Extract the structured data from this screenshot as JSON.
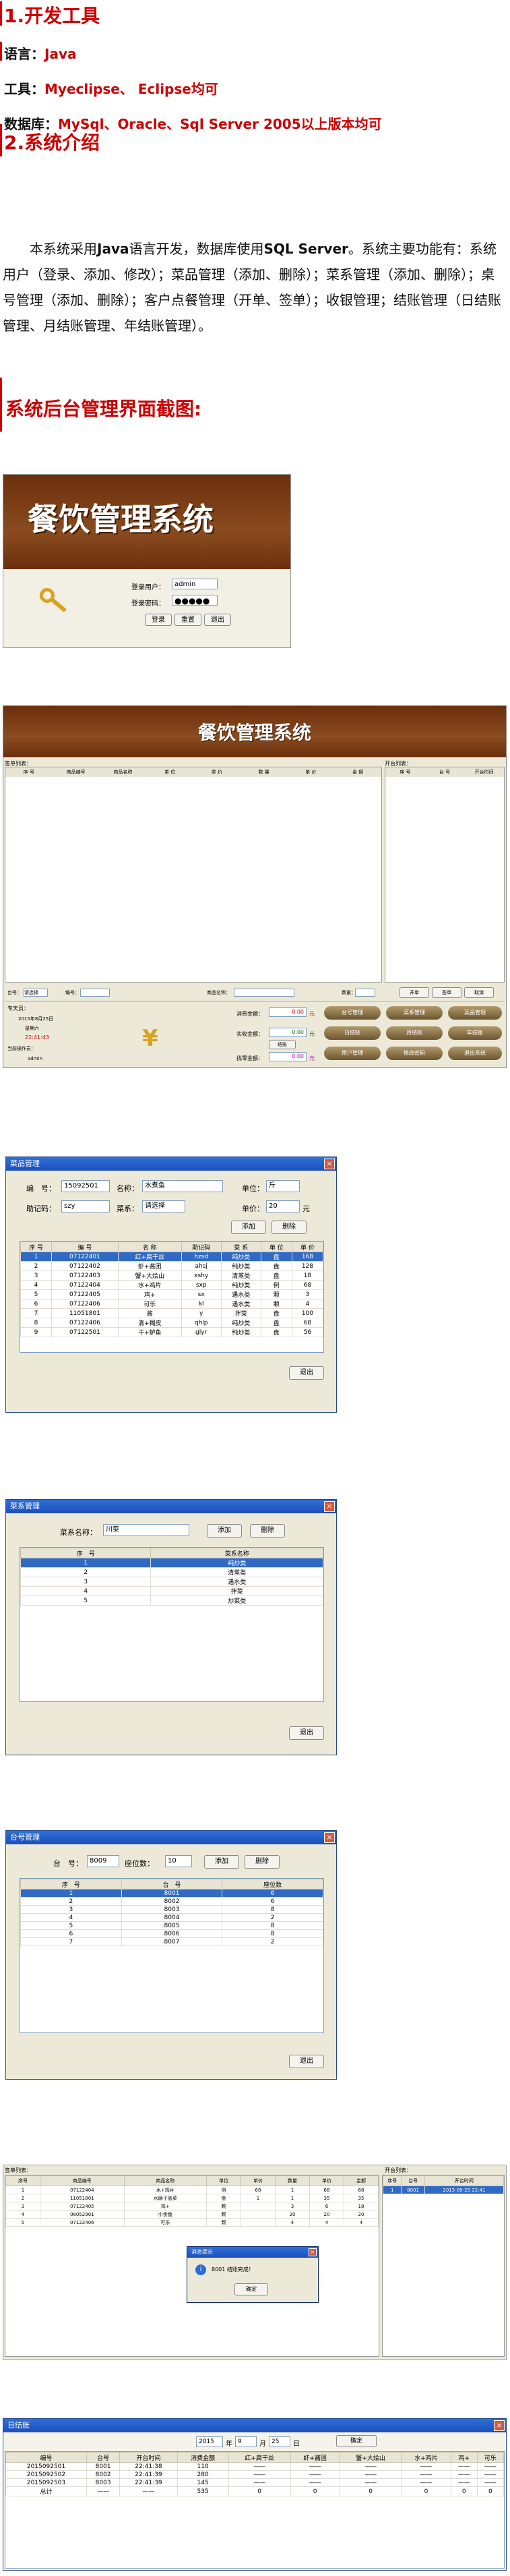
{
  "sections": {
    "tools_heading": "1.开发工具",
    "lang_label": "语言：",
    "lang_value": "Java",
    "tool_label": "工具：",
    "tool_value": "Myeclipse、 Eclipse均可",
    "db_label": "数据库：",
    "db_value": "MySql、Oracle、Sql Server 2005以上版本均可",
    "intro_heading": "2.系统介绍",
    "intro_p1": "本系统采用",
    "intro_java": "Java",
    "intro_p2": "语言开发，数据库使用",
    "intro_sql": "SQL Server",
    "intro_p3": "。系统主要功能有：系统用户（登录、添加、修改）；菜品管理（添加、删除）；菜系管理（添加、删除）；桌号管理（添加、删除）；客户点餐管理（开单、签单）；收银管理；结账管理（日结账管理、月结账管理、年结账管理）。",
    "screens_heading": "系统后台管理界面截图:"
  },
  "login": {
    "title": "餐饮管理系统",
    "user_label": "登录用户：",
    "user_value": "admin",
    "pwd_label": "登录密码：",
    "pwd_value": "●●●●●",
    "btn_login": "登录",
    "btn_reset": "重置",
    "btn_exit": "退出"
  },
  "main": {
    "title": "餐饮管理系统",
    "left_panel": "签单列表：",
    "right_panel": "开台列表：",
    "cols": [
      "序 号",
      "商品编号",
      "商品名称",
      "单 位",
      "单 价",
      "数 量",
      "单 价",
      "金 额"
    ],
    "rcols": [
      "序 号",
      "台 号",
      "开台时间"
    ],
    "bar": [
      "台号：",
      "请选择",
      "编号：",
      "商品名称：",
      "数量：",
      "开单",
      "签单",
      "取消"
    ],
    "user_lbl": "专天员：",
    "date": "2015年8月25日",
    "weekday": "星期六",
    "time": "22:41:43",
    "cur": "当前操作员：",
    "admin": "admin",
    "pay1": "消费金额：",
    "pay2": "实收金额：",
    "pay3": "找零金额：",
    "v1": "0.00",
    "v2": "0.00",
    "v3": "0.00",
    "yuan": "元",
    "checkout": "结账",
    "actions": [
      "台号管理",
      "菜系管理",
      "菜品管理",
      "日结账",
      "月结账",
      "年结账",
      "用户管理",
      "修改密码",
      "退出系统"
    ]
  },
  "menu": {
    "title": "菜品管理",
    "lbl_no": "编　号：",
    "no": "15092501",
    "lbl_name": "名称：",
    "name": "水煮鱼",
    "lbl_unit": "单位：",
    "unit": "斤",
    "lbl_code": "助记码：",
    "code": "szy",
    "lbl_type": "菜系：",
    "type": "请选择",
    "lbl_price": "单价：",
    "price": "20",
    "yuan": "元",
    "add": "添加",
    "del": "删除",
    "exit": "退出",
    "cols": [
      "序 号",
      "编 号",
      "名 称",
      "助记码",
      "菜 系",
      "单 位",
      "单 价"
    ],
    "rows": [
      [
        "1",
        "07122401",
        "红+腐干丝",
        "hzsd",
        "纯炒类",
        "盘",
        "168"
      ],
      [
        "2",
        "07122402",
        "虾+酱团",
        "ahsj",
        "纯炒类",
        "盘",
        "128"
      ],
      [
        "3",
        "07122403",
        "蟹+大烩山",
        "xshy",
        "清蒸类",
        "盘",
        "18"
      ],
      [
        "4",
        "07122404",
        "水+鸡片",
        "sxp",
        "纯炒类",
        "例",
        "68"
      ],
      [
        "5",
        "07122405",
        "鸡+",
        "sx",
        "遇水类",
        "颗",
        "3"
      ],
      [
        "6",
        "07122406",
        "可乐",
        "kl",
        "遇水类",
        "颗",
        "4"
      ],
      [
        "7",
        "11051801",
        "酱",
        "y",
        "拌菜",
        "盘",
        "100"
      ],
      [
        "8",
        "07122406",
        "清+糊皮",
        "qhlp",
        "纯炒类",
        "盘",
        "68"
      ],
      [
        "9",
        "07122501",
        "干+鲈鱼",
        "glyr",
        "纯炒类",
        "盘",
        "56"
      ]
    ]
  },
  "cuisine": {
    "title": "菜系管理",
    "lbl": "菜系名称：",
    "val": "川菜",
    "add": "添加",
    "del": "删除",
    "exit": "退出",
    "cols": [
      "序　号",
      "菜系名称"
    ],
    "rows": [
      [
        "1",
        "纯炒类"
      ],
      [
        "2",
        "清蒸类"
      ],
      [
        "3",
        "遇水类"
      ],
      [
        "4",
        "拌菜"
      ],
      [
        "5",
        "炒菜类"
      ]
    ]
  },
  "table": {
    "title": "台号管理",
    "lbl_no": "台　号：",
    "no": "8009",
    "lbl_seat": "座位数：",
    "seat": "10",
    "add": "添加",
    "del": "删除",
    "exit": "退出",
    "cols": [
      "序　号",
      "台　号",
      "座位数"
    ],
    "rows": [
      [
        "1",
        "8001",
        "6"
      ],
      [
        "2",
        "8002",
        "6"
      ],
      [
        "3",
        "8003",
        "8"
      ],
      [
        "4",
        "8004",
        "2"
      ],
      [
        "5",
        "8005",
        "8"
      ],
      [
        "6",
        "8006",
        "8"
      ],
      [
        "7",
        "8007",
        "2"
      ]
    ]
  },
  "order": {
    "left_panel": "签单列表：",
    "right_panel": "开台列表：",
    "cols": [
      "序号",
      "商品编号",
      "商品名称",
      "单位",
      "单价",
      "数量",
      "单价",
      "金额"
    ],
    "rows": [
      [
        "1",
        "07122404",
        "水+鸡片",
        "例",
        "68",
        "1",
        "68",
        "68"
      ],
      [
        "2",
        "11051801",
        "水磨子盖菜",
        "盘",
        "1",
        "1",
        "35",
        "35"
      ],
      [
        "3",
        "07122405",
        "鸡+",
        "颗",
        "",
        "3",
        "6",
        "18"
      ],
      [
        "4",
        "08052901",
        "小食鱼",
        "颗",
        "",
        "20",
        "20",
        "20"
      ],
      [
        "5",
        "07122406",
        "可乐",
        "颗",
        "",
        "4",
        "4",
        "4"
      ]
    ],
    "rcols": [
      "序号",
      "台号",
      "开台时间"
    ],
    "rrow": [
      "1",
      "8001",
      "2015-09-25 22:41"
    ],
    "dlg_title": "消息提示",
    "dlg_msg": "8001 结账完成！",
    "dlg_ok": "确定"
  },
  "daily": {
    "title": "日结账",
    "year": "2015",
    "y": "年",
    "month": "9",
    "m": "月",
    "day": "25",
    "d": "日",
    "ok": "确定",
    "cols": [
      "编号",
      "台号",
      "开台时间",
      "消费金额",
      "红+腐干丝",
      "虾+酱团",
      "蟹+大烩山",
      "水+鸡片",
      "鸡+",
      "可乐"
    ],
    "rows": [
      [
        "2015092501",
        "8001",
        "22:41:38",
        "110",
        "——",
        "——",
        "——",
        "——",
        "——",
        "——"
      ],
      [
        "2015092502",
        "8002",
        "22:41:39",
        "280",
        "——",
        "——",
        "——",
        "——",
        "——",
        "——"
      ],
      [
        "2015092503",
        "8003",
        "22:41:39",
        "145",
        "——",
        "——",
        "——",
        "——",
        "——",
        "——"
      ],
      [
        "总计",
        "——",
        "——",
        "535",
        "0",
        "0",
        "0",
        "0",
        "0",
        "0"
      ]
    ]
  }
}
